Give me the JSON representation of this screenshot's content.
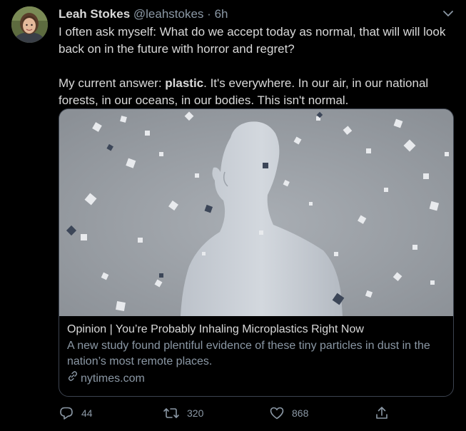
{
  "tweet": {
    "display_name": "Leah Stokes",
    "handle": "@leahstokes",
    "separator": "·",
    "time": "6h",
    "paragraph1": "I often ask myself: What do we accept today as normal, that will will look back on in the future with horror and regret?",
    "paragraph2_prefix": "My current answer: ",
    "paragraph2_bold": "plastic",
    "paragraph2_suffix": ". It's everywhere. In our air, in our national forests, in our oceans, in our bodies. This isn't normal."
  },
  "card": {
    "title": "Opinion | You’re Probably Inhaling Microplastics Right Now",
    "description": "A new study found plentiful evidence of these tiny particles in dust in the nation’s most remote places.",
    "domain": "nytimes.com"
  },
  "actions": {
    "reply_count": "44",
    "retweet_count": "320",
    "like_count": "868"
  },
  "icons": {
    "caret": "chevron-down-icon",
    "reply": "reply-icon",
    "retweet": "retweet-icon",
    "like": "heart-icon",
    "share": "share-icon",
    "link": "link-icon"
  },
  "colors": {
    "background": "#000000",
    "text": "#d9d9d9",
    "muted": "#8b98a5",
    "border": "#3d4450"
  }
}
